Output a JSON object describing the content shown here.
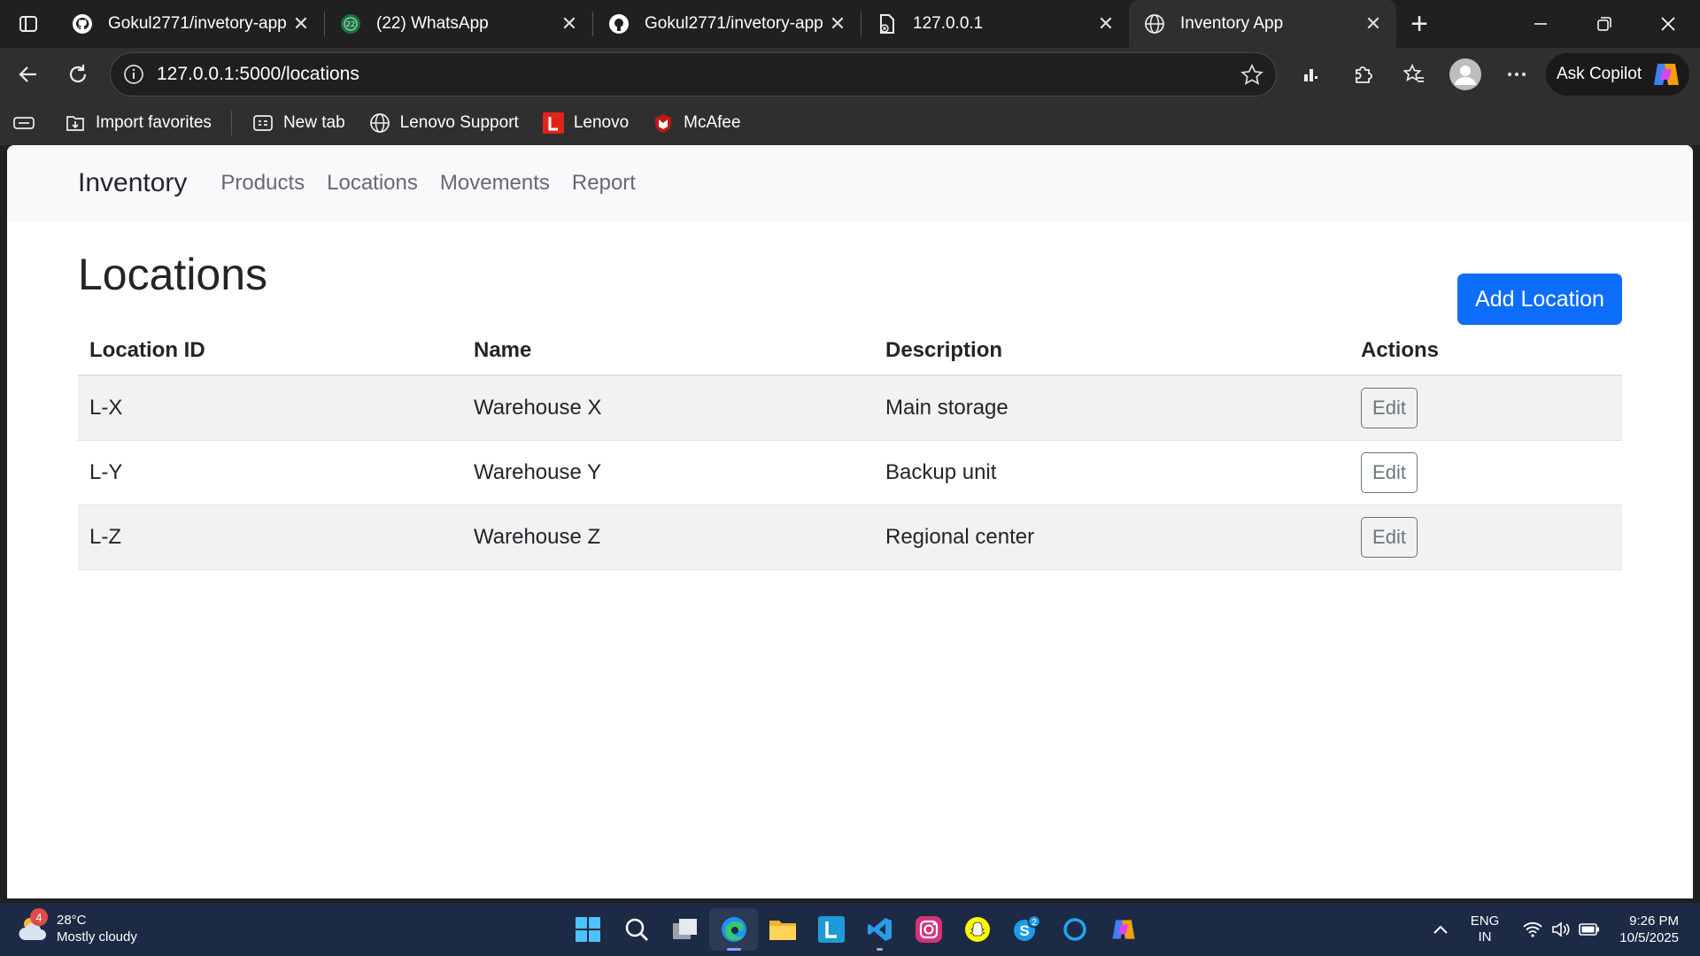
{
  "browser": {
    "tabs": [
      {
        "title": "Gokul2771/invetory-app",
        "icon": "github-icon",
        "active": false
      },
      {
        "title": "(22) WhatsApp",
        "icon": "whatsapp-icon",
        "active": false
      },
      {
        "title": "Gokul2771/invetory-app",
        "icon": "github-icon",
        "active": false
      },
      {
        "title": "127.0.0.1",
        "icon": "broken-page-icon",
        "active": false
      },
      {
        "title": "Inventory App",
        "icon": "globe-icon",
        "active": true
      }
    ],
    "url": "127.0.0.1:5000/locations",
    "copilot_label": "Ask Copilot",
    "favorites": [
      {
        "label": "Import favorites",
        "icon": "import-icon"
      },
      {
        "label": "New tab",
        "icon": "newtab-icon"
      },
      {
        "label": "Lenovo Support",
        "icon": "globe-icon"
      },
      {
        "label": "Lenovo",
        "icon": "lenovo-icon"
      },
      {
        "label": "McAfee",
        "icon": "mcafee-icon"
      }
    ]
  },
  "app": {
    "brand": "Inventory",
    "nav": [
      "Products",
      "Locations",
      "Movements",
      "Report"
    ],
    "page_title": "Locations",
    "add_button": "Add Location",
    "table": {
      "headers": [
        "Location ID",
        "Name",
        "Description",
        "Actions"
      ],
      "rows": [
        {
          "id": "L-X",
          "name": "Warehouse X",
          "description": "Main storage",
          "action": "Edit"
        },
        {
          "id": "L-Y",
          "name": "Warehouse Y",
          "description": "Backup unit",
          "action": "Edit"
        },
        {
          "id": "L-Z",
          "name": "Warehouse Z",
          "description": "Regional center",
          "action": "Edit"
        }
      ]
    },
    "colors": {
      "primary": "#0d6efd",
      "navbar_bg": "#f8f9fa",
      "stripe": "#f2f2f2"
    }
  },
  "taskbar": {
    "weather_temp": "28°C",
    "weather_desc": "Mostly cloudy",
    "weather_badge": "4",
    "lang_1": "ENG",
    "lang_2": "IN",
    "time": "9:26 PM",
    "date": "10/5/2025",
    "skype_badge": "2"
  }
}
